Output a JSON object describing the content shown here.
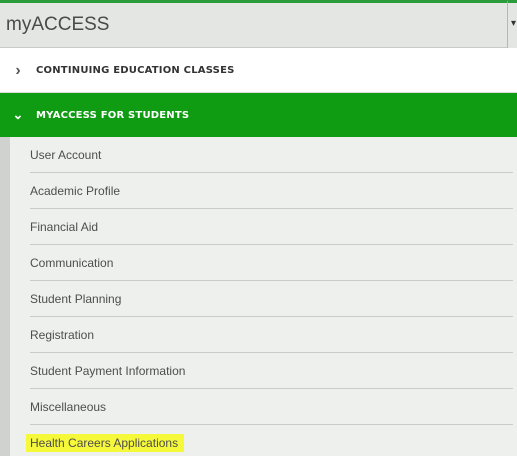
{
  "header": {
    "title": "myACCESS",
    "dropdown_glyph": "▾"
  },
  "sections": [
    {
      "label": "CONTINUING EDUCATION CLASSES",
      "chevron": "›",
      "expanded": false
    },
    {
      "label": "MYACCESS FOR STUDENTS",
      "chevron": "⌄",
      "expanded": true
    }
  ],
  "submenu": {
    "items": [
      {
        "label": "User Account"
      },
      {
        "label": "Academic Profile"
      },
      {
        "label": "Financial Aid"
      },
      {
        "label": "Communication"
      },
      {
        "label": "Student Planning"
      },
      {
        "label": "Registration"
      },
      {
        "label": "Student Payment Information"
      },
      {
        "label": "Miscellaneous"
      },
      {
        "label": "Health Careers Applications",
        "highlighted": true
      }
    ]
  },
  "colors": {
    "accent_green": "#109c12",
    "highlight_yellow": "#f6f93a"
  }
}
